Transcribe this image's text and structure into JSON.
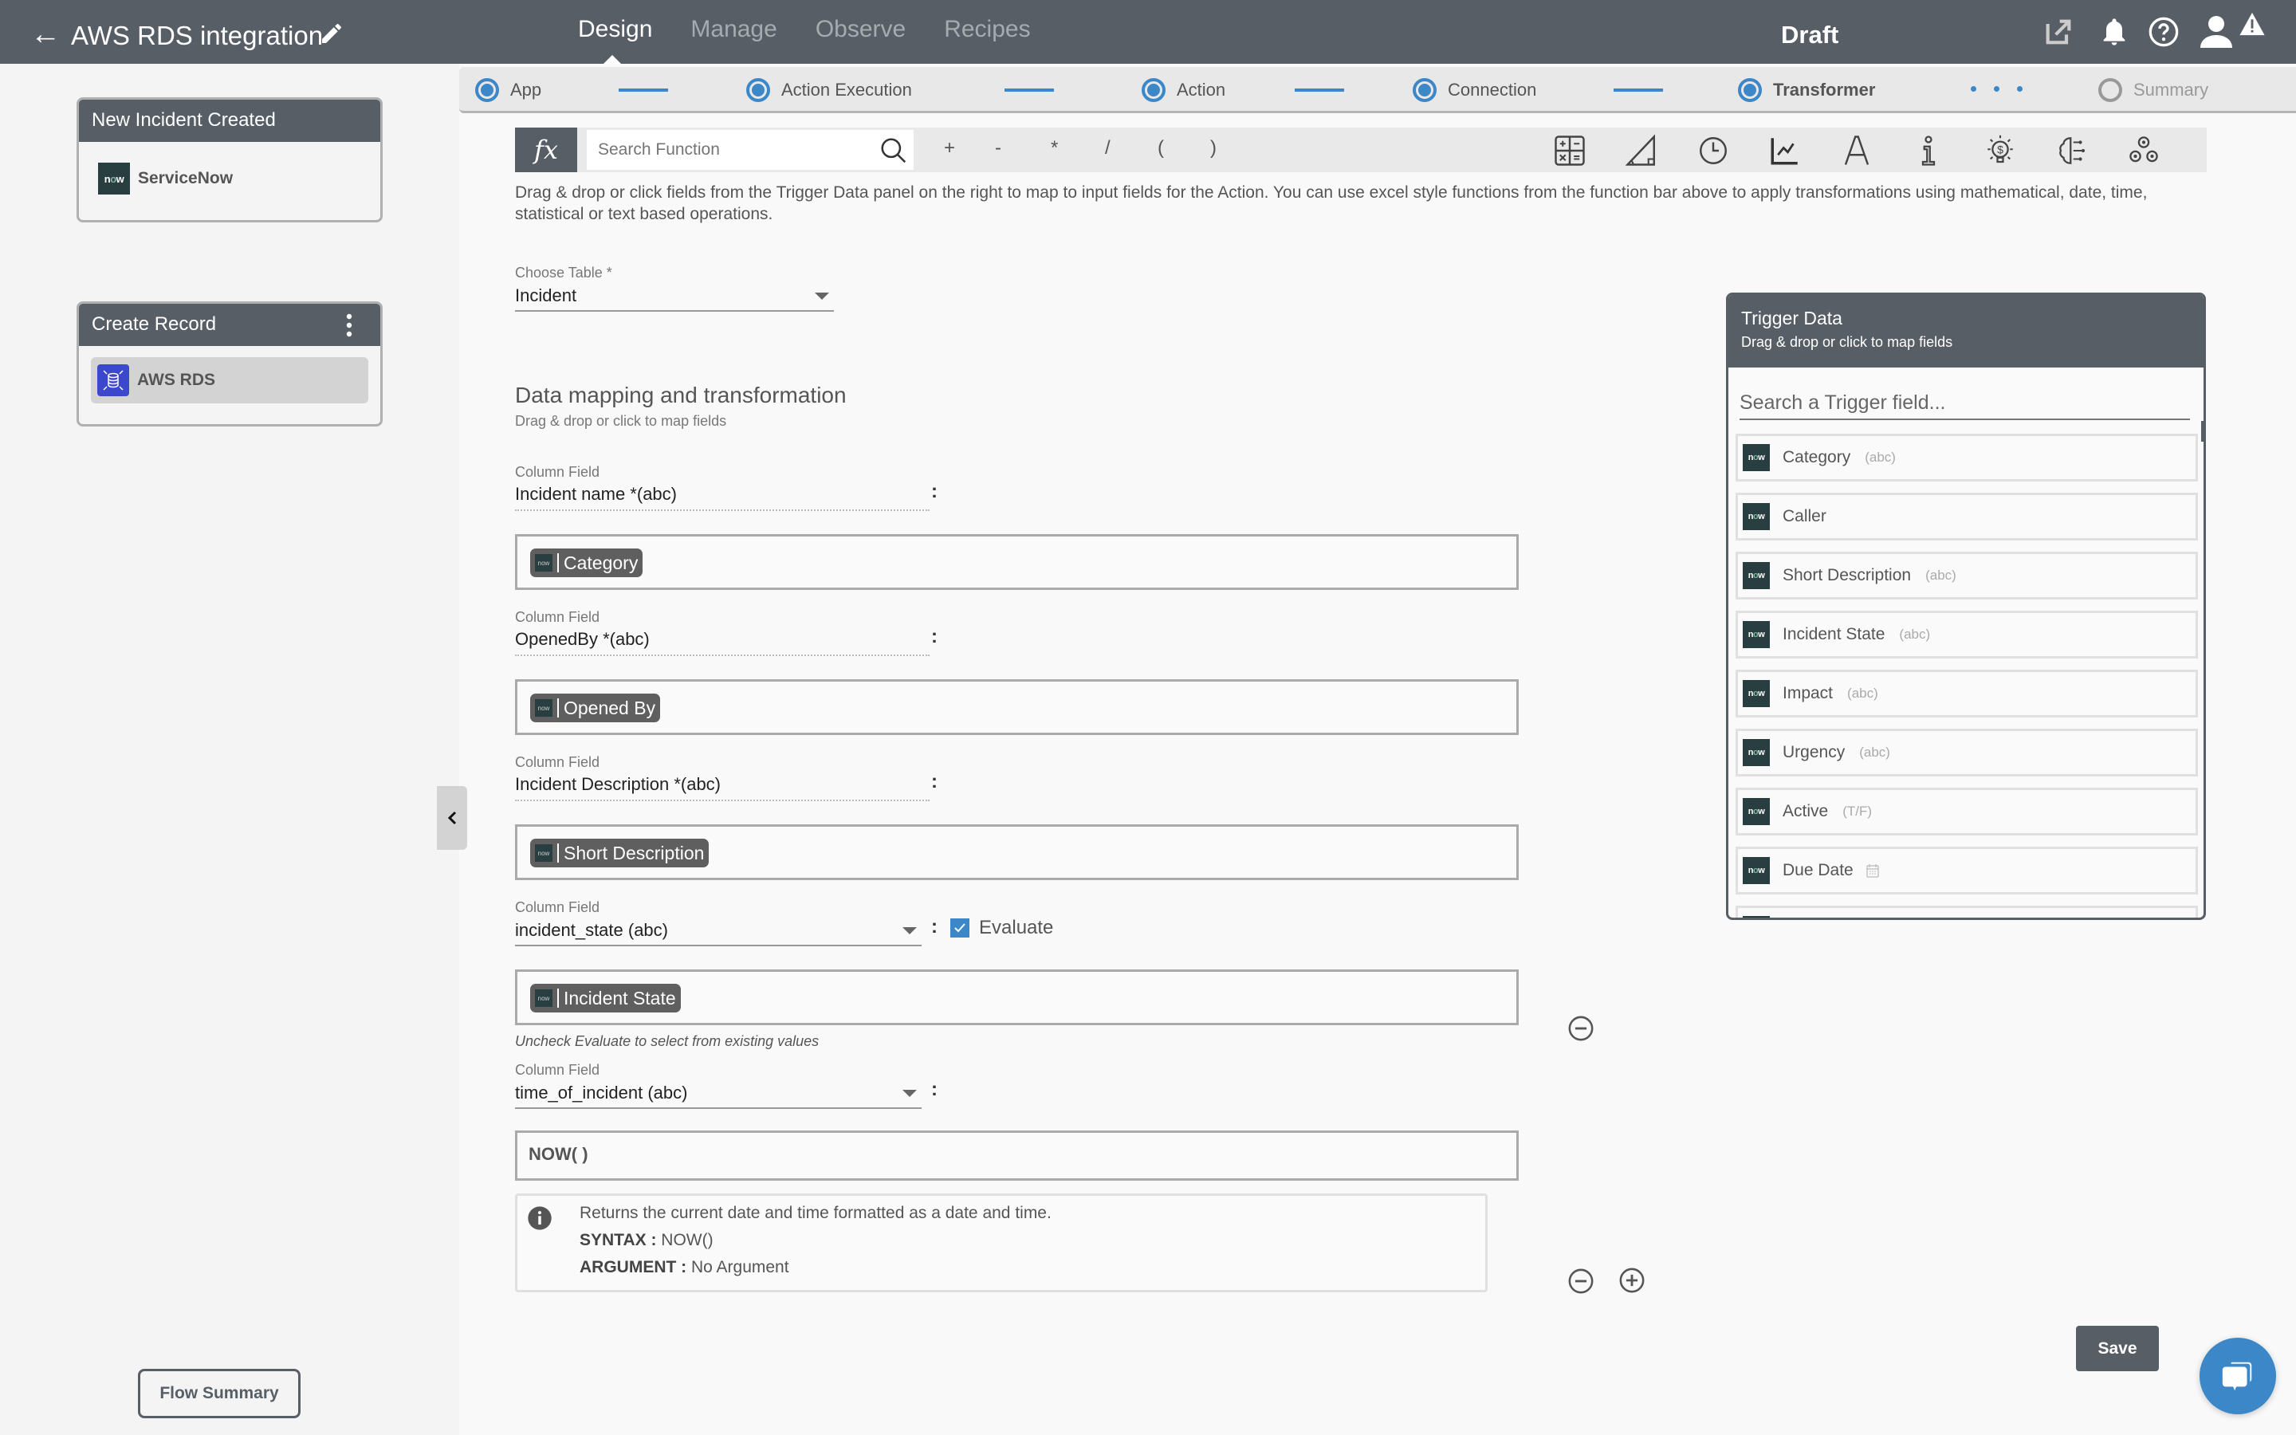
{
  "header": {
    "back_icon": "arrow-left-icon",
    "title": "AWS RDS integration",
    "edit_icon": "pencil-icon",
    "nav": [
      {
        "label": "Design",
        "active": true
      },
      {
        "label": "Manage",
        "active": false
      },
      {
        "label": "Observe",
        "active": false
      },
      {
        "label": "Recipes",
        "active": false
      }
    ],
    "status": "Draft",
    "icons": [
      "external-link-icon",
      "bell-icon",
      "help-icon",
      "user-icon",
      "warning-icon"
    ]
  },
  "sidebar": {
    "trigger_card": {
      "title": "New Incident Created",
      "app": "ServiceNow",
      "logo_text": "now"
    },
    "action_card": {
      "title": "Create Record",
      "app": "AWS RDS"
    },
    "flow_summary_label": "Flow Summary"
  },
  "stepper": {
    "steps": [
      {
        "label": "App",
        "state": "done"
      },
      {
        "label": "Action Execution",
        "state": "done"
      },
      {
        "label": "Action",
        "state": "done"
      },
      {
        "label": "Connection",
        "state": "done"
      },
      {
        "label": "Transformer",
        "state": "current"
      },
      {
        "label": "Summary",
        "state": "pending"
      }
    ]
  },
  "function_bar": {
    "fx_label": "fx",
    "search_placeholder": "Search Function",
    "operators": [
      "+",
      "-",
      "*",
      "/",
      "(",
      ")"
    ],
    "categories": [
      "calculator-icon",
      "trigonometry-icon",
      "clock-icon",
      "chart-icon",
      "text-icon",
      "info-icon",
      "financial-icon",
      "ai-brain-icon",
      "gears-icon"
    ]
  },
  "help_text": "Drag & drop or click fields from the Trigger Data panel on the right to map to input fields for the Action. You can use excel style functions from the function bar above to apply transformations using mathematical, date, time, statistical or text based operations.",
  "choose_table": {
    "label": "Choose Table *",
    "value": "Incident"
  },
  "mapping": {
    "title": "Data mapping and transformation",
    "subtitle": "Drag & drop or click to map fields",
    "rows": [
      {
        "label": "Column Field",
        "field": "Incident name *(abc)",
        "colon": ":",
        "value_pill": "Category"
      },
      {
        "label": "Column Field",
        "field": "OpenedBy *(abc)",
        "colon": ":",
        "value_pill": "Opened By"
      },
      {
        "label": "Column Field",
        "field": "Incident Description *(abc)",
        "colon": ":",
        "value_pill": "Short Description"
      },
      {
        "label": "Column Field",
        "field": "incident_state (abc)",
        "colon": ":",
        "value_pill": "Incident State",
        "evaluate_label": "Evaluate",
        "evaluate_checked": true,
        "hint": "Uncheck Evaluate to select from existing values"
      },
      {
        "label": "Column Field",
        "field": "time_of_incident (abc)",
        "colon": ":",
        "formula": "NOW( )"
      }
    ],
    "function_info": {
      "description": "Returns the current date and time formatted as a date and time.",
      "syntax_label": "SYNTAX :",
      "syntax": "NOW()",
      "argument_label": "ARGUMENT :",
      "argument": "No Argument"
    }
  },
  "trigger_panel": {
    "title": "Trigger Data",
    "subtitle": "Drag & drop or click to map fields",
    "search_placeholder": "Search a Trigger field...",
    "items": [
      {
        "name": "Category",
        "type": "(abc)"
      },
      {
        "name": "Caller",
        "type": ""
      },
      {
        "name": "Short Description",
        "type": "(abc)"
      },
      {
        "name": "Incident State",
        "type": "(abc)"
      },
      {
        "name": "Impact",
        "type": "(abc)"
      },
      {
        "name": "Urgency",
        "type": "(abc)"
      },
      {
        "name": "Active",
        "type": "(T/F)"
      },
      {
        "name": "Due Date",
        "type": "calendar-icon"
      }
    ]
  },
  "footer": {
    "save_label": "Save",
    "chat_icon": "chat-icon"
  },
  "colors": {
    "header": "#575e66",
    "accent": "#3c87c8",
    "servicenow": "#293e40",
    "aws_rds": "#3b48cc"
  }
}
